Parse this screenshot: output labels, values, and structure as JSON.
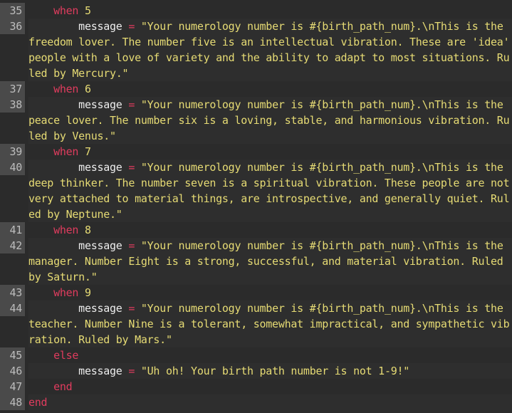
{
  "editor": {
    "lines": [
      {
        "n": "35",
        "parts": [
          {
            "t": "    ",
            "c": "ident"
          },
          {
            "t": "when",
            "c": "kw"
          },
          {
            "t": " 5",
            "c": "num"
          }
        ]
      },
      {
        "n": "36",
        "parts": [
          {
            "t": "        message",
            "c": "ident"
          },
          {
            "t": " = ",
            "c": "op"
          },
          {
            "t": "\"Your numerology number is #{birth_path_num}.\\nThis is the freedom lover. The number five is an intellectual vibration. These are 'idea' people with a love of variety and the ability to adapt to most situations. Ruled by Mercury.\"",
            "c": "str"
          }
        ]
      },
      {
        "n": "37",
        "parts": [
          {
            "t": "    ",
            "c": "ident"
          },
          {
            "t": "when",
            "c": "kw"
          },
          {
            "t": " 6",
            "c": "num"
          }
        ]
      },
      {
        "n": "38",
        "parts": [
          {
            "t": "        message",
            "c": "ident"
          },
          {
            "t": " = ",
            "c": "op"
          },
          {
            "t": "\"Your numerology number is #{birth_path_num}.\\nThis is the peace lover. The number six is a loving, stable, and harmonious vibration. Ruled by Venus.\"",
            "c": "str"
          }
        ]
      },
      {
        "n": "39",
        "parts": [
          {
            "t": "    ",
            "c": "ident"
          },
          {
            "t": "when",
            "c": "kw"
          },
          {
            "t": " 7",
            "c": "num"
          }
        ]
      },
      {
        "n": "40",
        "parts": [
          {
            "t": "        message",
            "c": "ident"
          },
          {
            "t": " = ",
            "c": "op"
          },
          {
            "t": "\"Your numerology number is #{birth_path_num}.\\nThis is the deep thinker. The number seven is a spiritual vibration. These people are not very attached to material things, are introspective, and generally quiet. Ruled by Neptune.\"",
            "c": "str"
          }
        ]
      },
      {
        "n": "41",
        "parts": [
          {
            "t": "    ",
            "c": "ident"
          },
          {
            "t": "when",
            "c": "kw"
          },
          {
            "t": " 8",
            "c": "num"
          }
        ]
      },
      {
        "n": "42",
        "parts": [
          {
            "t": "        message",
            "c": "ident"
          },
          {
            "t": " = ",
            "c": "op"
          },
          {
            "t": "\"Your numerology number is #{birth_path_num}.\\nThis is the manager. Number Eight is a strong, successful, and material vibration. Ruled by Saturn.\"",
            "c": "str"
          }
        ]
      },
      {
        "n": "43",
        "parts": [
          {
            "t": "    ",
            "c": "ident"
          },
          {
            "t": "when",
            "c": "kw"
          },
          {
            "t": " 9",
            "c": "num"
          }
        ]
      },
      {
        "n": "44",
        "parts": [
          {
            "t": "        message",
            "c": "ident"
          },
          {
            "t": " = ",
            "c": "op"
          },
          {
            "t": "\"Your numerology number is #{birth_path_num}.\\nThis is the teacher. Number Nine is a tolerant, somewhat impractical, and sympathetic vibration. Ruled by Mars.\"",
            "c": "str"
          }
        ]
      },
      {
        "n": "45",
        "parts": [
          {
            "t": "    ",
            "c": "ident"
          },
          {
            "t": "else",
            "c": "kw"
          }
        ]
      },
      {
        "n": "46",
        "parts": [
          {
            "t": "        message",
            "c": "ident"
          },
          {
            "t": " = ",
            "c": "op"
          },
          {
            "t": "\"Uh oh! Your birth path number is not 1-9!\"",
            "c": "str"
          }
        ]
      },
      {
        "n": "47",
        "parts": [
          {
            "t": "    ",
            "c": "ident"
          },
          {
            "t": "end",
            "c": "kw"
          }
        ]
      },
      {
        "n": "48",
        "parts": [
          {
            "t": "end",
            "c": "kw"
          }
        ]
      }
    ]
  },
  "colors": {
    "background": "#2b2b2b",
    "gutter": "#4a4a4a",
    "keyword": "#e03c5e",
    "string": "#e6db74",
    "identifier": "#ededed"
  }
}
